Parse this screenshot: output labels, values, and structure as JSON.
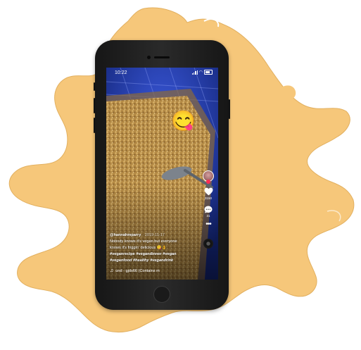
{
  "colors": {
    "splash": "#f6c77a",
    "splash_outline": "#e2b060",
    "phone_body": "#1e1e1e",
    "tiktok_red": "#fe2c55"
  },
  "status_bar": {
    "time": "10:22"
  },
  "post": {
    "username": "@hannahmparry",
    "date": "· 2019-11-17",
    "caption_line1": "Nobody knows it's vegan but everyone",
    "caption_line2": "knows it's friggin' delicious 😋👌",
    "hashtags_line1": "#veganrecipe #vegandinner #vegan",
    "hashtags_line2": "#veganfood #healthy #vegandrink",
    "sound": "und - gjds66 (Contains m",
    "emoji": "😋"
  },
  "actions": {
    "likes": "3150",
    "comments": "31",
    "icons": [
      "avatar",
      "heart-icon",
      "comment-icon",
      "more-icon",
      "music-disc-icon"
    ]
  }
}
